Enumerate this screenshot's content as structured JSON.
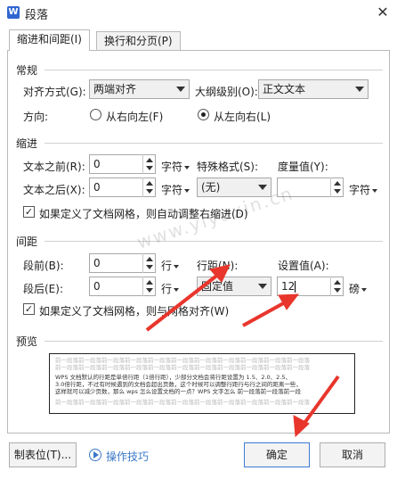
{
  "window": {
    "title": "段落",
    "app_icon_text": "W"
  },
  "tabs": [
    {
      "label": "缩进和间距(I)",
      "active": true
    },
    {
      "label": "换行和分页(P)",
      "active": false
    }
  ],
  "general": {
    "section": "常规",
    "alignment_label": "对齐方式(G):",
    "alignment_value": "两端对齐",
    "outline_label": "大纲级别(O):",
    "outline_value": "正文文本",
    "direction_label": "方向:",
    "rtl_label": "从右向左(F)",
    "ltr_label": "从左向右(L)",
    "selected_direction": "ltr"
  },
  "indent": {
    "section": "缩进",
    "before_label": "文本之前(R):",
    "before_value": "0",
    "before_unit": "字符",
    "after_label": "文本之后(X):",
    "after_value": "0",
    "after_unit": "字符",
    "special_label": "特殊格式(S):",
    "special_value": "(无)",
    "measure_label": "度量值(Y):",
    "measure_value": "",
    "measure_unit": "字符",
    "grid_check_label": "如果定义了文档网格，则自动调整右缩进(D)",
    "grid_checked": true
  },
  "spacing": {
    "section": "间距",
    "before_label": "段前(B):",
    "before_value": "0",
    "before_unit": "行",
    "after_label": "段后(E):",
    "after_value": "0",
    "after_unit": "行",
    "line_label": "行距(N):",
    "line_value": "固定值",
    "setting_label": "设置值(A):",
    "setting_value": "12",
    "setting_unit": "磅",
    "snap_check_label": "如果定义了文档网格，则与网格对齐(W)",
    "snap_checked": true
  },
  "preview": {
    "section": "预览",
    "prev_lines": [
      "前一段落前一段落前一段落前一段落前一段落前一段落前一段落前一段落前一段落前一段落前一段落",
      "前一段落前一段落前一段落前一段落前一段落前一段落前一段落前一段落前一段落前一段落前一段落"
    ],
    "sample_lines": [
      "WPS 文档默认的行距是单倍行距（1倍行距），少部分文档会将行距设置为 1.5、2.0、2.5、",
      "3.0倍行距，不过有时候遇到的文档会超出页数，这个时候可以调整行距行与行之间的距离一些，",
      "这样就可以减少页数，那么 wps 怎么设置文档的一点？WPS 文字怎么 前一段落前一段落前一段"
    ],
    "next_lines": [
      "前一段落前一段落前一段落前一段落前一段落前一段落前一段落前一段落前一段落前一段落前一段落"
    ]
  },
  "watermark": "www.yiyuxin.cn",
  "footer": {
    "tabs_button": "制表位(T)...",
    "tips_link": "操作技巧",
    "ok_button": "确定",
    "cancel_button": "取消"
  },
  "colors": {
    "accent": "#3a78c8",
    "annotation_arrow": "#e8362c"
  }
}
